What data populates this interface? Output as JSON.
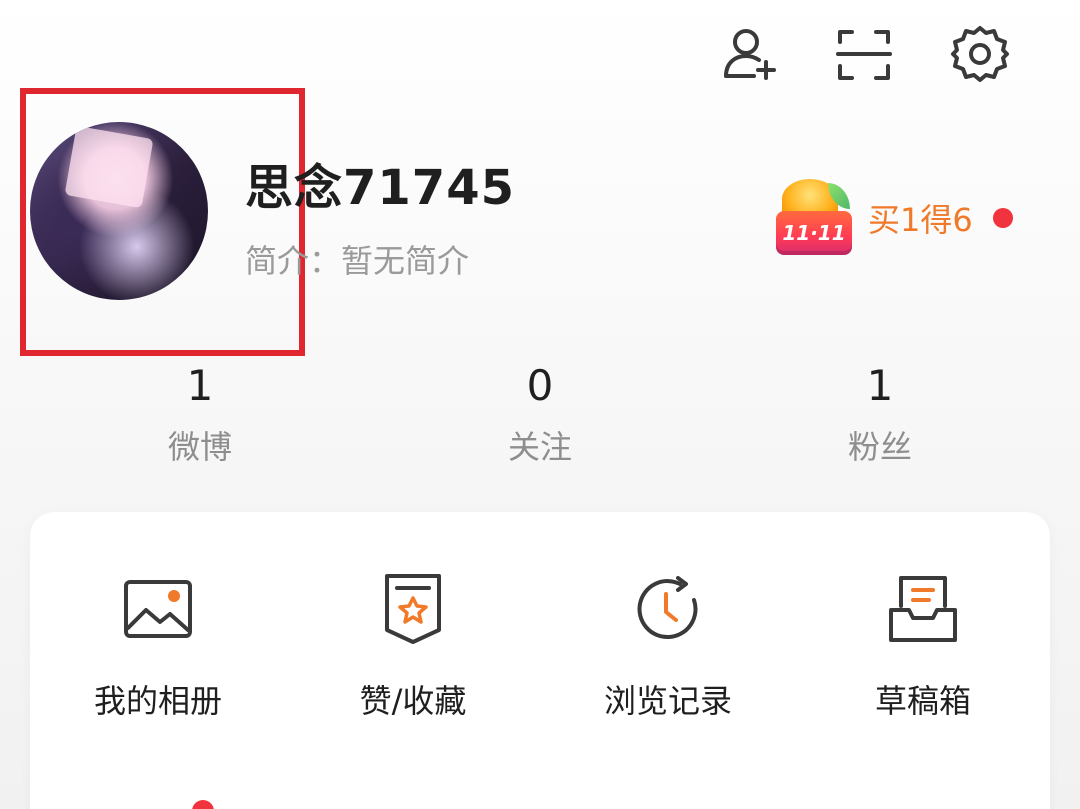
{
  "header": {
    "icons": [
      "add-friend-icon",
      "scan-icon",
      "settings-icon"
    ]
  },
  "profile": {
    "nickname": "思念71745",
    "bio": "简介：暂无简介"
  },
  "promo": {
    "badge_text": "11·11",
    "label": "买1得6",
    "accent_color": "#f07a2a",
    "dot_color": "#f1333d"
  },
  "stats": [
    {
      "value": "1",
      "label": "微博"
    },
    {
      "value": "0",
      "label": "关注"
    },
    {
      "value": "1",
      "label": "粉丝"
    }
  ],
  "tools": [
    {
      "label": "我的相册",
      "icon": "photo-album-icon"
    },
    {
      "label": "赞/收藏",
      "icon": "favorites-icon"
    },
    {
      "label": "浏览记录",
      "icon": "history-icon"
    },
    {
      "label": "草稿箱",
      "icon": "drafts-icon"
    }
  ],
  "colors": {
    "highlight_box": "#e0262f",
    "icon_orange": "#f07a2a",
    "icon_dark": "#3a3a3a"
  }
}
